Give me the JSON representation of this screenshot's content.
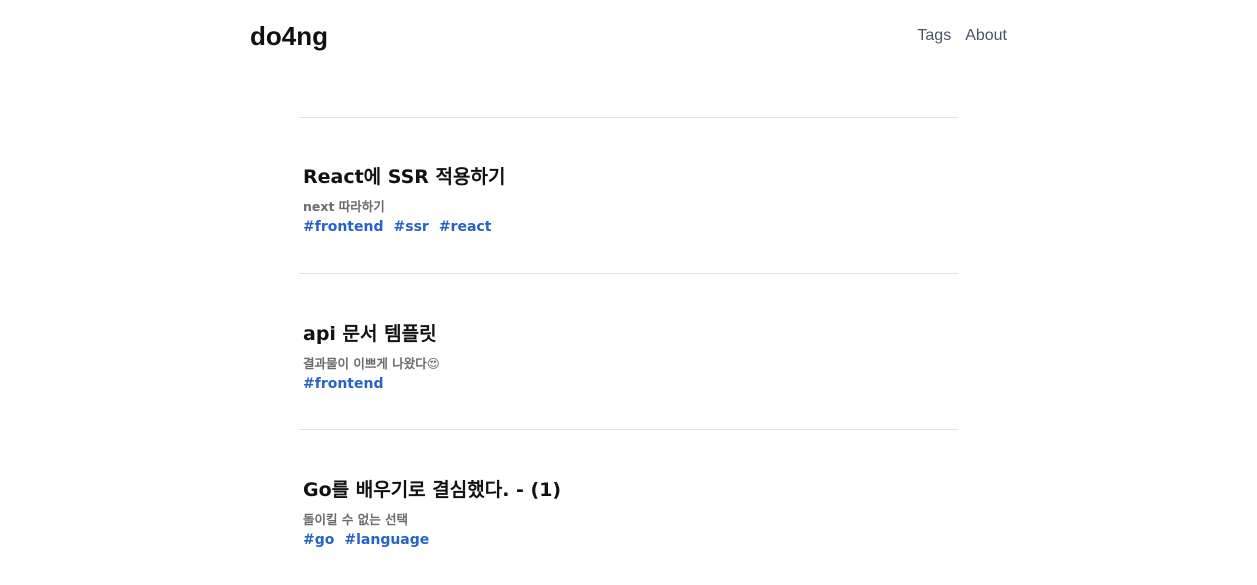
{
  "header": {
    "logo": "do4ng",
    "nav": [
      {
        "label": "Tags"
      },
      {
        "label": "About"
      }
    ]
  },
  "posts": [
    {
      "title": "React에 SSR 적용하기",
      "description": "next 따라하기",
      "tags": [
        "#frontend",
        "#ssr",
        "#react"
      ]
    },
    {
      "title": "api 문서 템플릿",
      "description": "결과물이 이쁘게 나왔다😍",
      "tags": [
        "#frontend"
      ]
    },
    {
      "title": "Go를 배우기로 결심했다. - (1)",
      "description": "돌이킬 수 없는 선택",
      "tags": [
        "#go",
        "#language"
      ]
    }
  ]
}
